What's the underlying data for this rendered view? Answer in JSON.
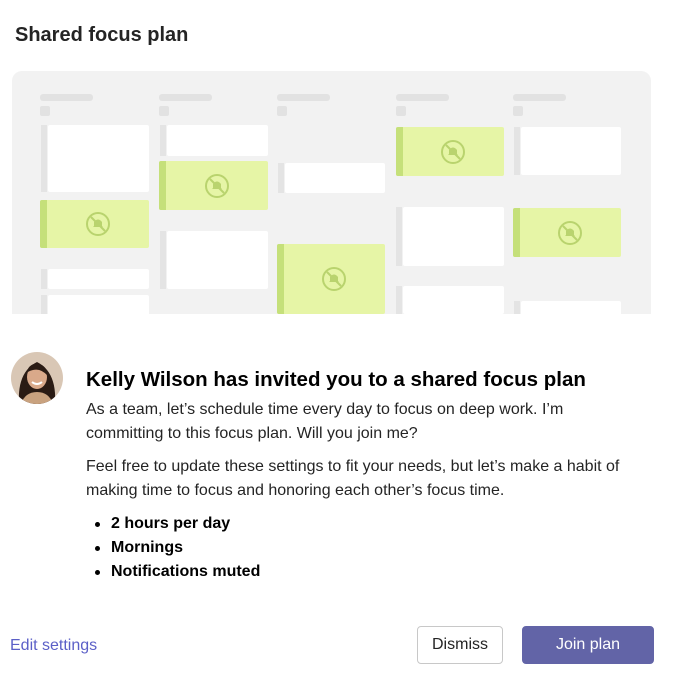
{
  "dialog": {
    "title": "Shared focus plan"
  },
  "invite": {
    "title": "Kelly Wilson has invited you to a shared focus plan",
    "paragraph1": "As a team, let’s schedule time every day to focus on deep work. I’m committing to this focus plan. Will you join me?",
    "paragraph2": "Feel free to update these settings to fit your needs, but let’s make a habit of making time to focus and honoring each other’s focus time.",
    "bullets": [
      "2 hours per day",
      "Mornings",
      "Notifications muted"
    ]
  },
  "actions": {
    "edit_settings": "Edit settings",
    "dismiss": "Dismiss",
    "join_plan": "Join plan"
  },
  "icons": {
    "focus_block": "notifications-muted-icon",
    "avatar": "user-avatar-photo"
  },
  "colors": {
    "accent": "#6264a7",
    "link": "#5b5fc7",
    "focus_fill": "#e6f5a6",
    "focus_bar": "#c5e07a",
    "calendar_bg": "#f2f2f2"
  }
}
